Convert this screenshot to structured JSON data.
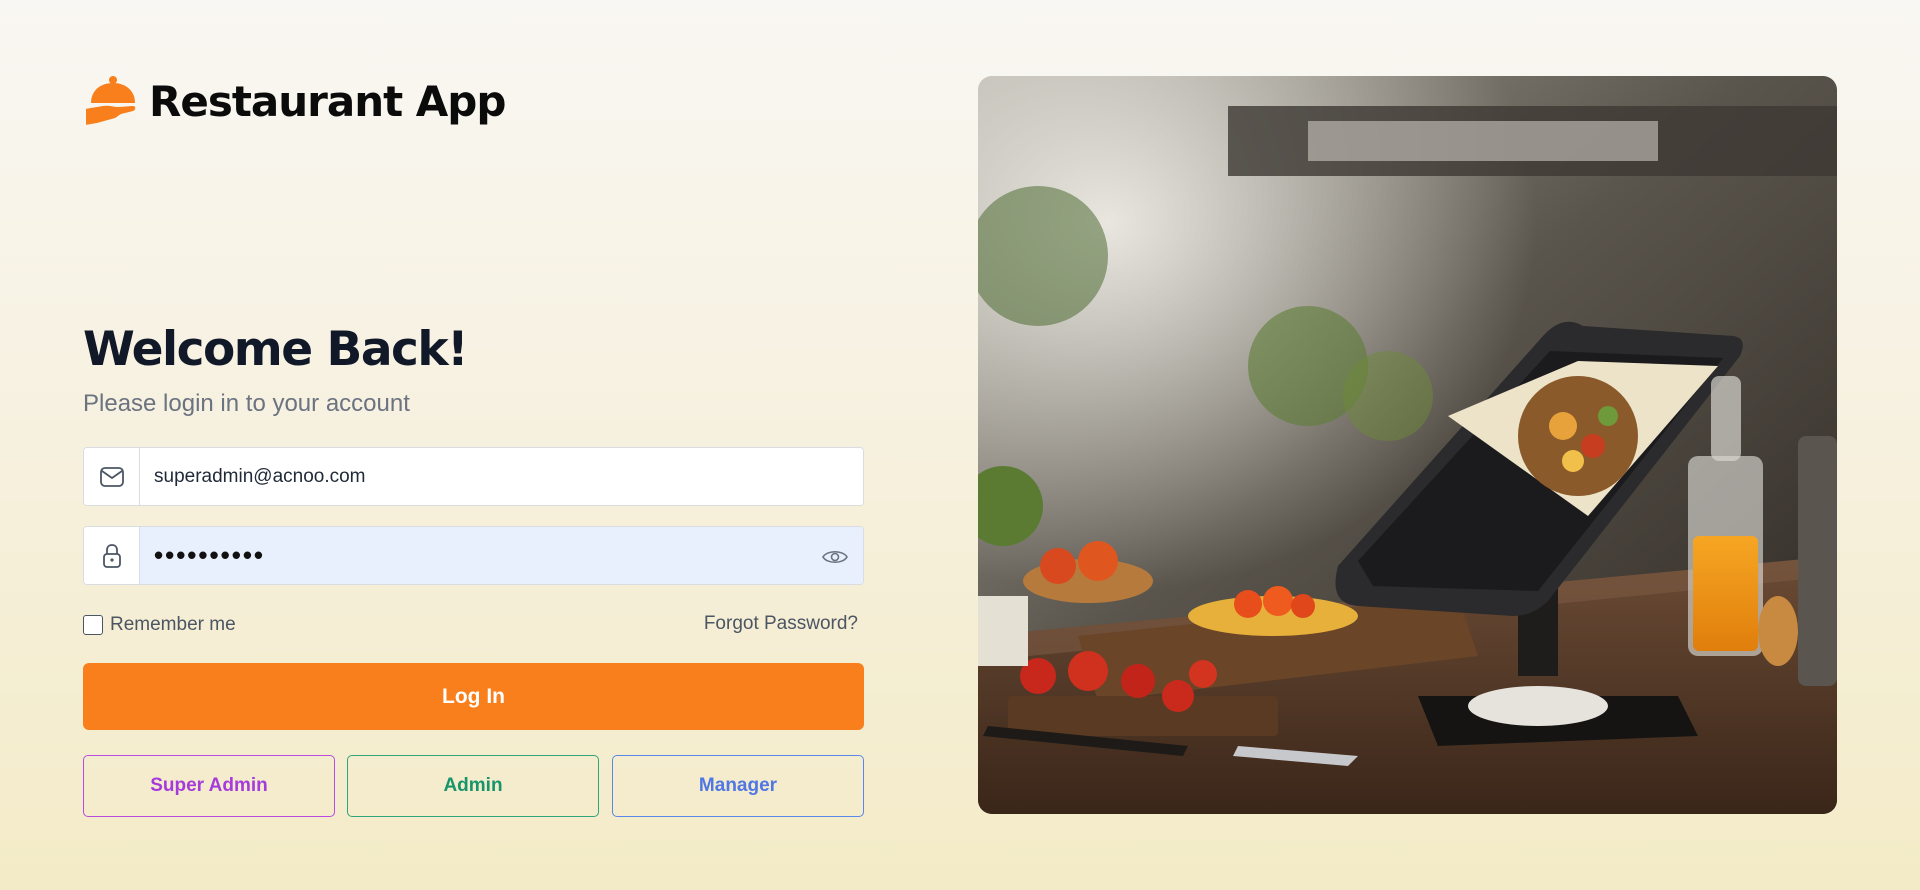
{
  "brand": {
    "name": "Restaurant App",
    "logo_icon": "serving-cloche-icon"
  },
  "heading": {
    "title": "Welcome Back!",
    "subtitle": "Please login in to your account"
  },
  "form": {
    "email": {
      "icon": "envelope-icon",
      "value": "superadmin@acnoo.com"
    },
    "password": {
      "icon": "lock-icon",
      "masked_value": "••••••••••",
      "toggle_icon": "eye-icon"
    },
    "remember_label": "Remember me",
    "remember_checked": false,
    "forgot_label": "Forgot Password?",
    "login_label": "Log In"
  },
  "roles": [
    {
      "label": "Super Admin",
      "color": "#a63bdc"
    },
    {
      "label": "Admin",
      "color": "#16956a"
    },
    {
      "label": "Manager",
      "color": "#4f77e5"
    }
  ],
  "colors": {
    "accent": "#f97f1c",
    "password_bg": "#e8effd"
  },
  "hero": {
    "subject": "tablet-pos-on-restaurant-counter-photo"
  }
}
